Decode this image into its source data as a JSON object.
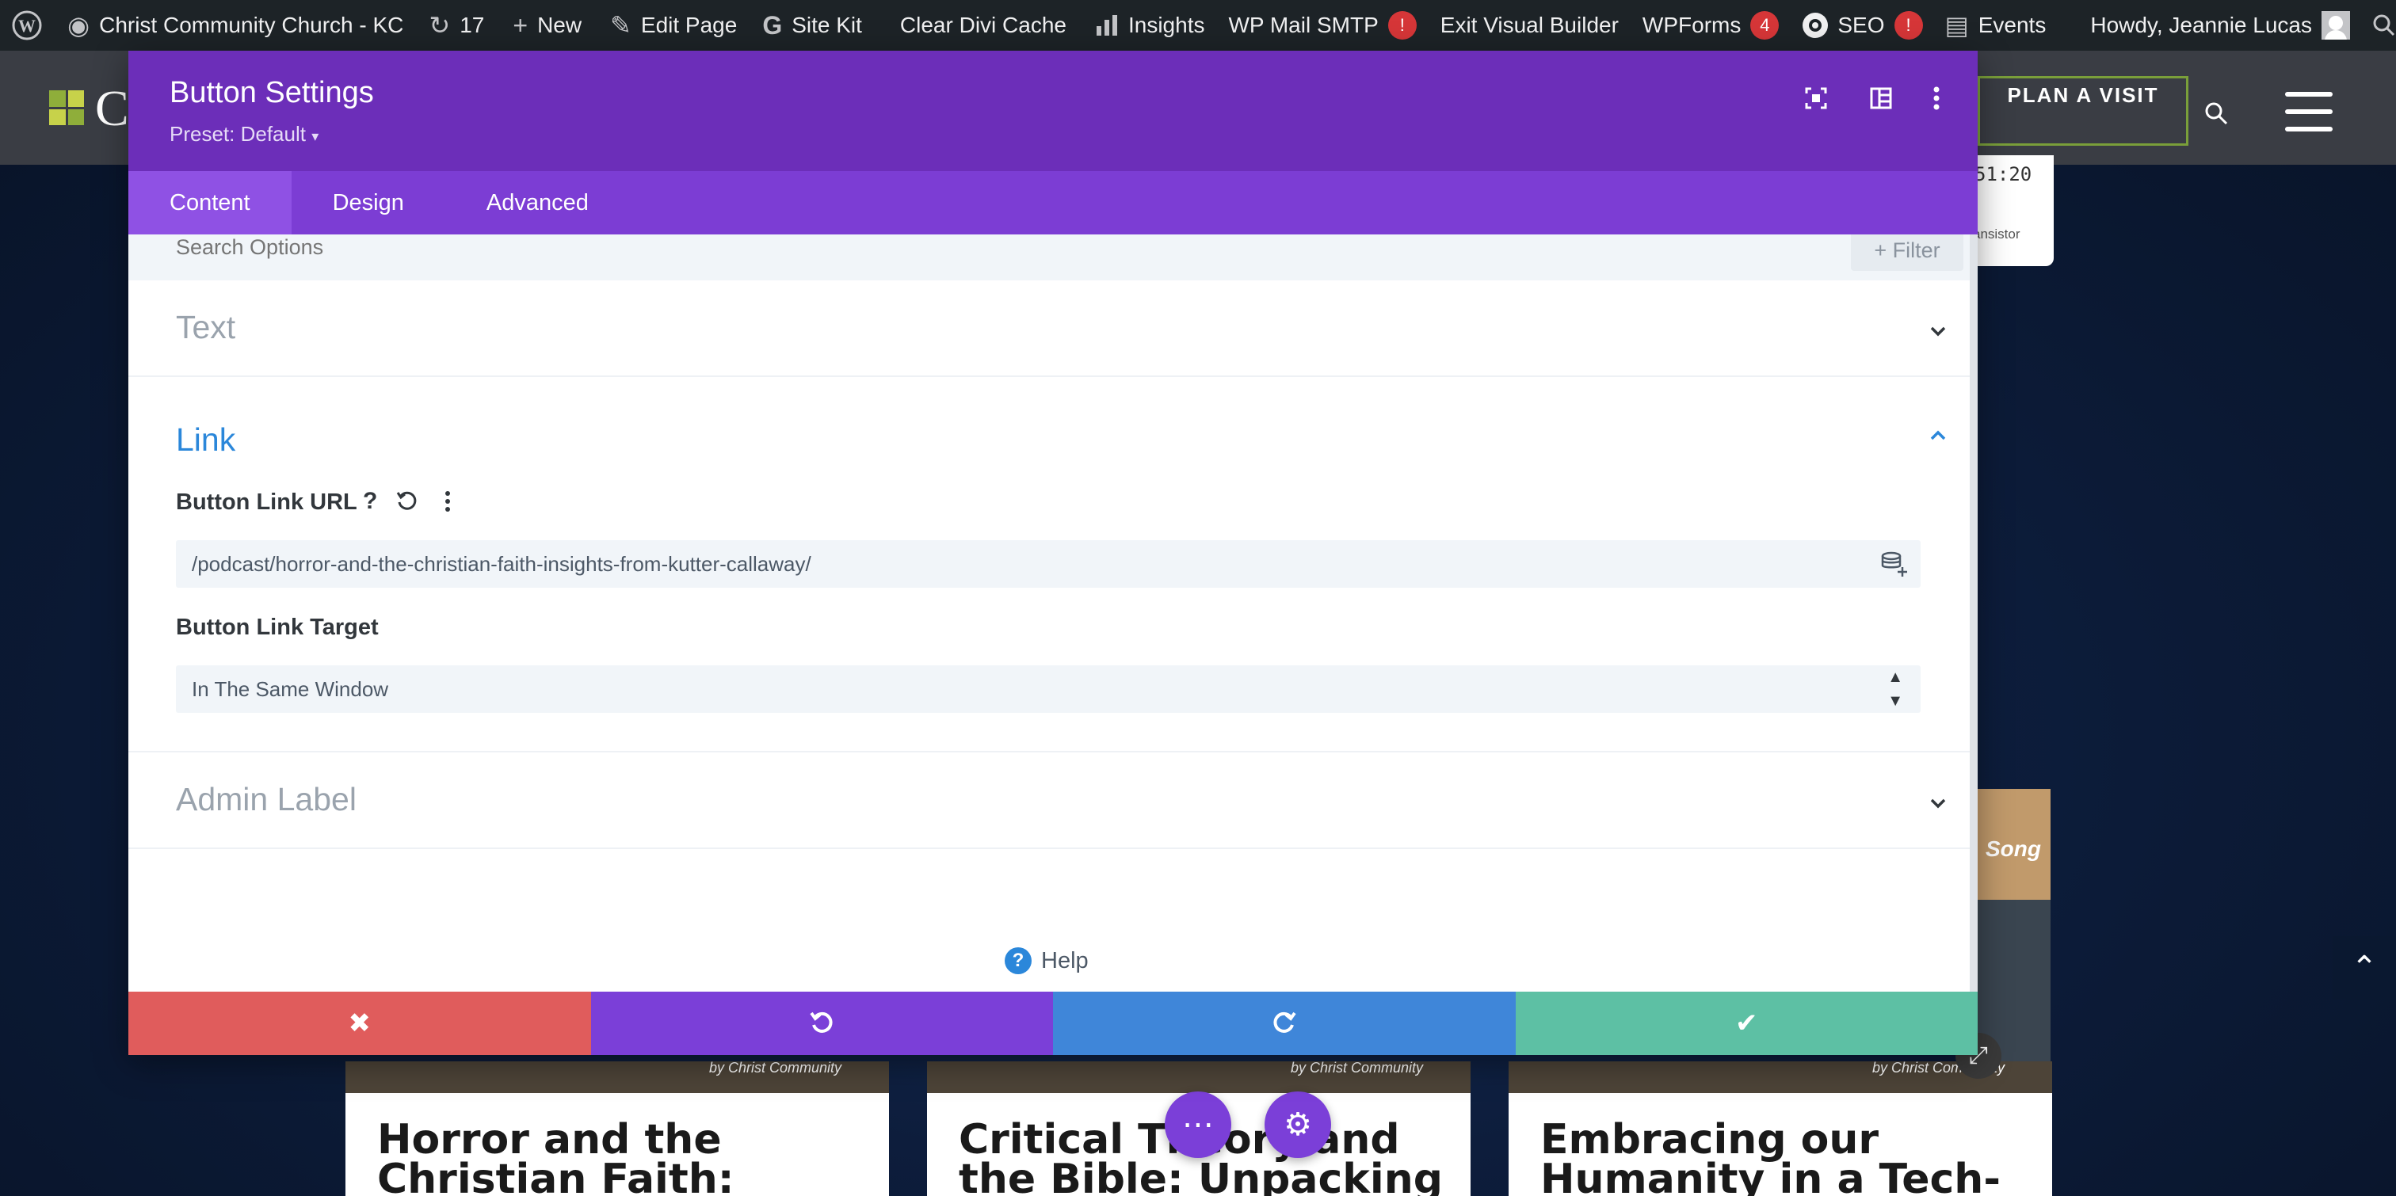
{
  "admin_bar": {
    "site_name": "Christ Community Church - KC",
    "updates_count": "17",
    "new_label": "New",
    "edit_page_label": "Edit Page",
    "site_kit_label": "Site Kit",
    "clear_cache_label": "Clear Divi Cache",
    "insights_label": "Insights",
    "wp_mail_label": "WP Mail SMTP",
    "wp_mail_badge": "!",
    "exit_builder_label": "Exit Visual Builder",
    "wpforms_label": "WPForms",
    "wpforms_badge": "4",
    "seo_label": "SEO",
    "seo_badge": "!",
    "events_label": "Events",
    "howdy_label": "Howdy, Jeannie Lucas"
  },
  "site": {
    "logo_letter": "C",
    "plan_visit_label": "PLAN A VISIT",
    "side_card_clock": "51:20",
    "side_card_text": "ansistor",
    "song_label": "Song",
    "posts": [
      {
        "title": "Horror and the Christian Faith:",
        "thumb_caption": "by Christ Community"
      },
      {
        "title": "Critical Theory and the Bible: Unpacking",
        "thumb_caption": "by Christ Community"
      },
      {
        "title": "Embracing our Humanity in a Tech-",
        "thumb_caption": "by Christ Community"
      }
    ]
  },
  "modal": {
    "title": "Button Settings",
    "preset": "Preset: Default",
    "tabs": [
      "Content",
      "Design",
      "Advanced"
    ],
    "active_tab": "Content",
    "search_placeholder": "Search Options",
    "filter_label": "+ Filter",
    "sections": {
      "text": "Text",
      "link": "Link",
      "admin_label": "Admin Label"
    },
    "fields": {
      "url_label": "Button Link URL",
      "url_value": "/podcast/horror-and-the-christian-faith-insights-from-kutter-callaway/",
      "target_label": "Button Link Target",
      "target_value": "In The Same Window"
    },
    "help_label": "Help"
  },
  "colors": {
    "modal_header": "#6c2eb9",
    "modal_tabs": "#7c3dd4",
    "cancel": "#e05c5c",
    "undo": "#7b3fd8",
    "redo": "#3f86d9",
    "save": "#5dc0a4",
    "link_blue": "#2b87da"
  }
}
